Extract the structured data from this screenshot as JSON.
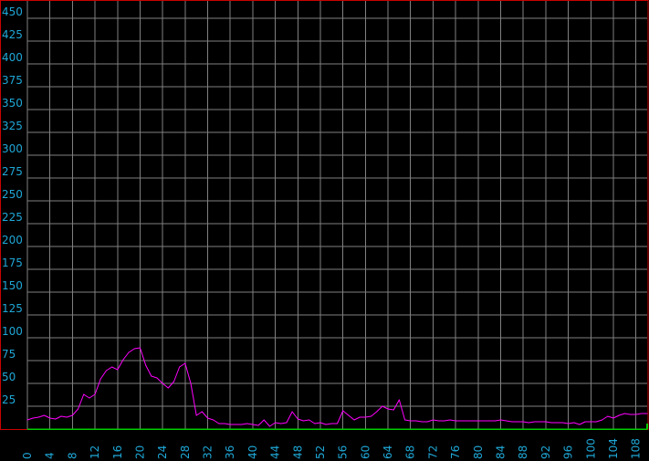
{
  "chart_data": {
    "type": "line",
    "title": "",
    "xlabel": "",
    "ylabel": "",
    "xlim": [
      0,
      110
    ],
    "ylim": [
      0,
      470
    ],
    "grid": true,
    "colors": {
      "background": "#000000",
      "grid": "#808080",
      "line": "#ff00ff",
      "baseline": "#00cc00",
      "frame": "#cc0000",
      "tick_label": "#1fa7d6"
    },
    "y_ticks": [
      "25",
      "50",
      "75",
      "100",
      "125",
      "150",
      "175",
      "200",
      "225",
      "250",
      "275",
      "300",
      "325",
      "350",
      "375",
      "400",
      "425",
      "450"
    ],
    "x_ticks": [
      "0",
      "4",
      "8",
      "12",
      "16",
      "20",
      "24",
      "28",
      "32",
      "36",
      "40",
      "44",
      "48",
      "52",
      "56",
      "60",
      "64",
      "68",
      "72",
      "76",
      "80",
      "84",
      "88",
      "92",
      "96",
      "100",
      "104",
      "108"
    ],
    "series": [
      {
        "x": [
          0,
          1,
          2,
          3,
          4,
          5,
          6,
          7,
          8,
          9,
          10,
          11,
          12,
          13,
          14,
          15,
          16,
          17,
          18,
          19,
          20,
          21,
          22,
          23,
          24,
          25,
          26,
          27,
          28,
          29,
          30,
          31,
          32,
          33,
          34,
          35,
          36,
          37,
          38,
          39,
          40,
          41,
          42,
          43,
          44,
          45,
          46,
          47,
          48,
          49,
          50,
          51,
          52,
          53,
          54,
          55,
          56,
          57,
          58,
          59,
          60,
          61,
          62,
          63,
          64,
          65,
          66,
          67,
          68,
          69,
          70,
          71,
          72,
          73,
          74,
          75,
          76,
          77,
          78,
          79,
          80,
          81,
          82,
          83,
          84,
          85,
          86,
          87,
          88,
          89,
          90,
          91,
          92,
          93,
          94,
          95,
          96,
          97,
          98,
          99,
          100,
          101,
          102,
          103,
          104,
          105,
          106,
          107,
          108,
          109,
          110
        ],
        "values": [
          10,
          12,
          13,
          15,
          12,
          11,
          14,
          13,
          15,
          22,
          38,
          34,
          38,
          55,
          64,
          68,
          65,
          76,
          84,
          88,
          89,
          70,
          58,
          56,
          50,
          45,
          52,
          68,
          72,
          50,
          15,
          19,
          12,
          10,
          6,
          6,
          5,
          5,
          5,
          6,
          5,
          4,
          10,
          3,
          7,
          6,
          7,
          19,
          11,
          9,
          10,
          6,
          7,
          5,
          6,
          6,
          20,
          15,
          10,
          13,
          13,
          14,
          19,
          25,
          22,
          21,
          32,
          10,
          9,
          9,
          8,
          8,
          10,
          9,
          9,
          10,
          9,
          9,
          9,
          9,
          9,
          9,
          9,
          9,
          10,
          9,
          8,
          8,
          8,
          7,
          8,
          8,
          8,
          7,
          7,
          7,
          6,
          7,
          5,
          8,
          8,
          8,
          10,
          14,
          12,
          15,
          17,
          16,
          16,
          17,
          17
        ]
      }
    ]
  }
}
